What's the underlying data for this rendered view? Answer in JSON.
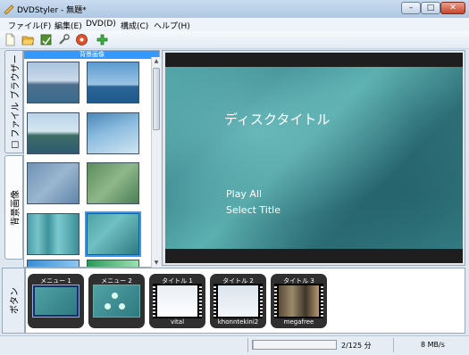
{
  "window": {
    "title": "DVDStyler - 無題*"
  },
  "menubar": {
    "items": [
      "ファイル(F)",
      "編集(E)",
      "DVD(D)",
      "構成(C)",
      "ヘルプ(H)"
    ]
  },
  "toolbar": {
    "icons": [
      "new-file-icon",
      "open-folder-icon",
      "save-icon",
      "settings-wrench-icon",
      "burn-disc-icon",
      "add-icon"
    ]
  },
  "sidebar": {
    "tabs": [
      {
        "label": "ファイル ブラウザー",
        "icon": "checkbox-icon"
      },
      {
        "label": "背景画像"
      },
      {
        "label": "ボタン"
      }
    ]
  },
  "backgrounds": {
    "header": "背景画像"
  },
  "preview": {
    "title": "ディスクタイトル",
    "buttons": [
      "Play All",
      "Select Title"
    ]
  },
  "timeline": {
    "items": [
      {
        "label": "メニュー 1",
        "name": ""
      },
      {
        "label": "メニュー 2",
        "name": ""
      },
      {
        "label": "タイトル 1",
        "name": "vital"
      },
      {
        "label": "タイトル 2",
        "name": "khonntekini2"
      },
      {
        "label": "タイトル 3",
        "name": "megafree"
      }
    ]
  },
  "status": {
    "progress": 0.016,
    "disk_usage": "2/125 分",
    "speed": "8 MB/s"
  },
  "colors": {
    "accent": "#3399ff",
    "preview_teal": "#4fa2a4"
  }
}
